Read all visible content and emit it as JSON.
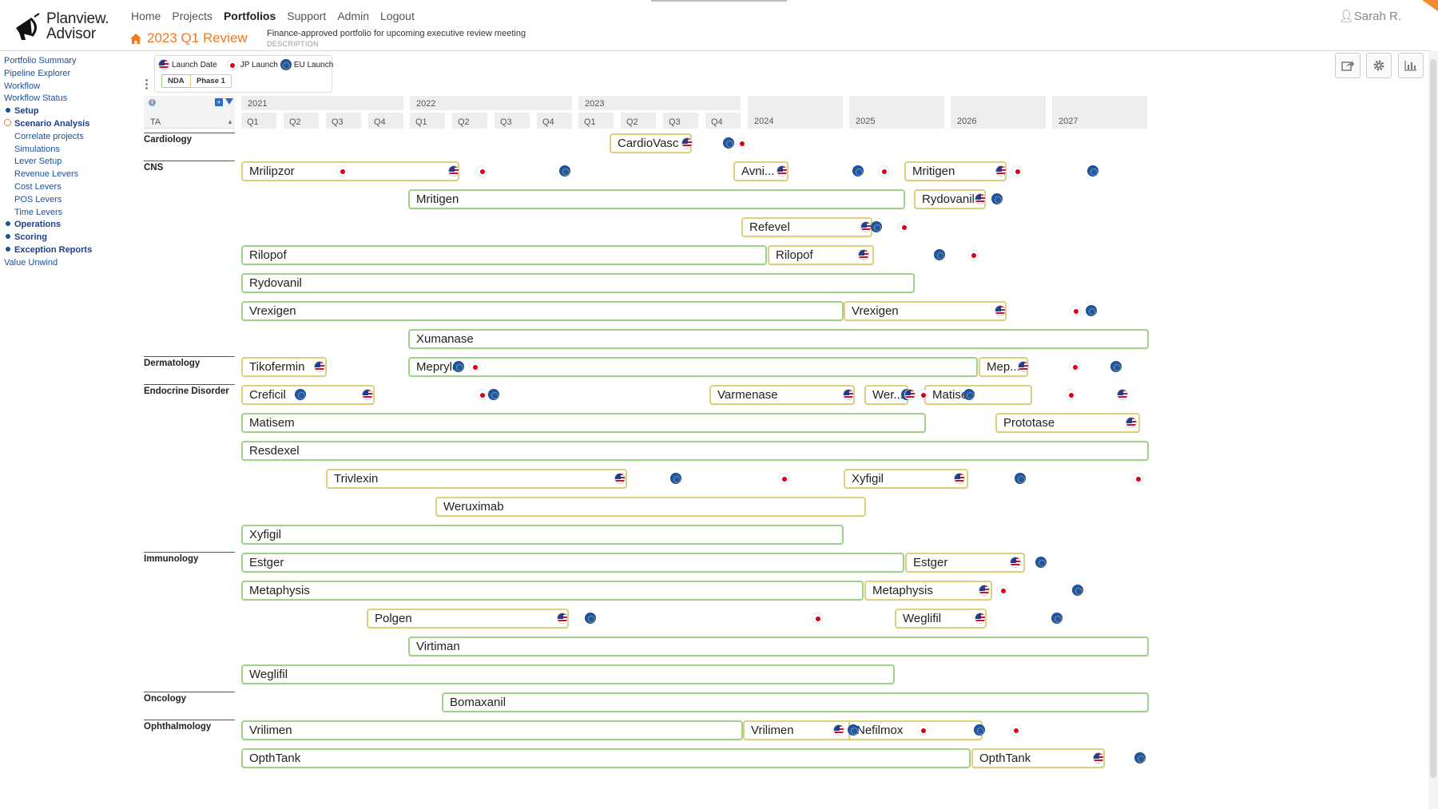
{
  "app": {
    "logo_line1": "Planview.",
    "logo_line2": "Advisor"
  },
  "nav": [
    "Home",
    "Projects",
    "Portfolios",
    "Support",
    "Admin",
    "Logout"
  ],
  "nav_active": "Portfolios",
  "user": "Sarah R.",
  "portfolio": {
    "title": "2023 Q1 Review",
    "description": "Finance-approved portfolio for upcoming executive review meeting",
    "description_label": "DESCRIPTION"
  },
  "sidebar": [
    {
      "label": "Portfolio Summary",
      "level": 0
    },
    {
      "label": "Pipeline Explorer",
      "level": 0
    },
    {
      "label": "Workflow",
      "level": 0
    },
    {
      "label": "Workflow Status",
      "level": 0
    },
    {
      "label": "Setup",
      "level": 1,
      "marker": "dot"
    },
    {
      "label": "Scenario Analysis",
      "level": 1,
      "marker": "ring"
    },
    {
      "label": "Correlate projects",
      "level": 2
    },
    {
      "label": "Simulations",
      "level": 2
    },
    {
      "label": "Lever Setup",
      "level": 2
    },
    {
      "label": "Revenue Levers",
      "level": 2
    },
    {
      "label": "Cost Levers",
      "level": 2
    },
    {
      "label": "POS Levers",
      "level": 2
    },
    {
      "label": "Time Levers",
      "level": 2
    },
    {
      "label": "Operations",
      "level": 1,
      "marker": "dot"
    },
    {
      "label": "Scoring",
      "level": 1,
      "marker": "dot"
    },
    {
      "label": "Exception Reports",
      "level": 1,
      "marker": "dot"
    },
    {
      "label": "Value Unwind",
      "level": 0
    }
  ],
  "legend": {
    "launch_date": "Launch Date",
    "jp_launch": "JP Launch",
    "eu_launch": "EU Launch",
    "chip_nda": "NDA",
    "chip_phase1": "Phase 1",
    "chip_nda_color": "#9fd08c",
    "chip_phase1_color": "#ddd07a"
  },
  "timeline": {
    "ta_header": "TA",
    "years_with_quarters": [
      {
        "year": "2021",
        "quarters": [
          "Q1",
          "Q2",
          "Q3",
          "Q4"
        ]
      },
      {
        "year": "2022",
        "quarters": [
          "Q1",
          "Q2",
          "Q3",
          "Q4"
        ]
      },
      {
        "year": "2023",
        "quarters": [
          "Q1",
          "Q2",
          "Q3",
          "Q4"
        ]
      }
    ],
    "years": [
      "2024",
      "2025",
      "2026",
      "2027"
    ]
  },
  "colors": {
    "accent": "#f07a22",
    "link": "#1d4f9c",
    "nda_border": "#9fd08c",
    "phase1_border": "#ddd07a"
  },
  "therapeutic_areas": [
    {
      "name": "Cardiology",
      "rows": [
        [
          {
            "name": "CardioVasc",
            "phase": "phase1"
          }
        ]
      ]
    },
    {
      "name": "CNS",
      "rows": [
        [
          {
            "name": "Mrilipzor",
            "phase": "phase1"
          },
          {
            "name": "Avni...",
            "phase": "phase1"
          },
          {
            "name": "Mritigen",
            "phase": "phase1"
          }
        ],
        [
          {
            "name": "Mritigen",
            "phase": "nda"
          },
          {
            "name": "Rydovanil",
            "phase": "phase1"
          }
        ],
        [
          {
            "name": "Refevel",
            "phase": "phase1"
          }
        ],
        [
          {
            "name": "Rilopof",
            "phase": "nda"
          },
          {
            "name": "Rilopof",
            "phase": "phase1"
          }
        ],
        [
          {
            "name": "Rydovanil",
            "phase": "nda"
          }
        ],
        [
          {
            "name": "Vrexigen",
            "phase": "nda"
          },
          {
            "name": "Vrexigen",
            "phase": "phase1"
          }
        ],
        [
          {
            "name": "Xumanase",
            "phase": "nda"
          }
        ]
      ]
    },
    {
      "name": "Dermatology",
      "rows": [
        [
          {
            "name": "Tikofermin",
            "phase": "phase1"
          },
          {
            "name": "Meprylo",
            "phase": "nda"
          },
          {
            "name": "Mep...",
            "phase": "phase1"
          }
        ]
      ]
    },
    {
      "name": "Endocrine Disorder",
      "rows": [
        [
          {
            "name": "Creficil",
            "phase": "phase1"
          },
          {
            "name": "Varmenase",
            "phase": "phase1"
          },
          {
            "name": "Wer...",
            "phase": "phase1"
          },
          {
            "name": "Matise",
            "phase": "phase1"
          }
        ],
        [
          {
            "name": "Matisem",
            "phase": "nda"
          },
          {
            "name": "Prototase",
            "phase": "phase1"
          }
        ],
        [
          {
            "name": "Resdexel",
            "phase": "nda"
          }
        ],
        [
          {
            "name": "Trivlexin",
            "phase": "phase1"
          },
          {
            "name": "Xyfigil",
            "phase": "phase1"
          }
        ],
        [
          {
            "name": "Weruximab",
            "phase": "phase1"
          }
        ],
        [
          {
            "name": "Xyfigil",
            "phase": "nda"
          }
        ]
      ]
    },
    {
      "name": "Immunology",
      "rows": [
        [
          {
            "name": "Estger",
            "phase": "nda"
          },
          {
            "name": "Estger",
            "phase": "phase1"
          }
        ],
        [
          {
            "name": "Metaphysis",
            "phase": "nda"
          },
          {
            "name": "Metaphysis",
            "phase": "phase1"
          }
        ],
        [
          {
            "name": "Polgen",
            "phase": "phase1"
          },
          {
            "name": "Weglifil",
            "phase": "phase1"
          }
        ],
        [
          {
            "name": "Virtiman",
            "phase": "nda"
          }
        ],
        [
          {
            "name": "Weglifil",
            "phase": "nda"
          }
        ]
      ]
    },
    {
      "name": "Oncology",
      "rows": [
        [
          {
            "name": "Bomaxanil",
            "phase": "nda"
          }
        ]
      ]
    },
    {
      "name": "Ophthalmology",
      "rows": [
        [
          {
            "name": "Vrilimen",
            "phase": "nda"
          },
          {
            "name": "Vrilimen",
            "phase": "phase1"
          },
          {
            "name": "Nefilmox",
            "phase": "phase1"
          }
        ],
        [
          {
            "name": "OpthTank",
            "phase": "nda"
          },
          {
            "name": "OpthTank",
            "phase": "phase1"
          }
        ]
      ]
    }
  ]
}
